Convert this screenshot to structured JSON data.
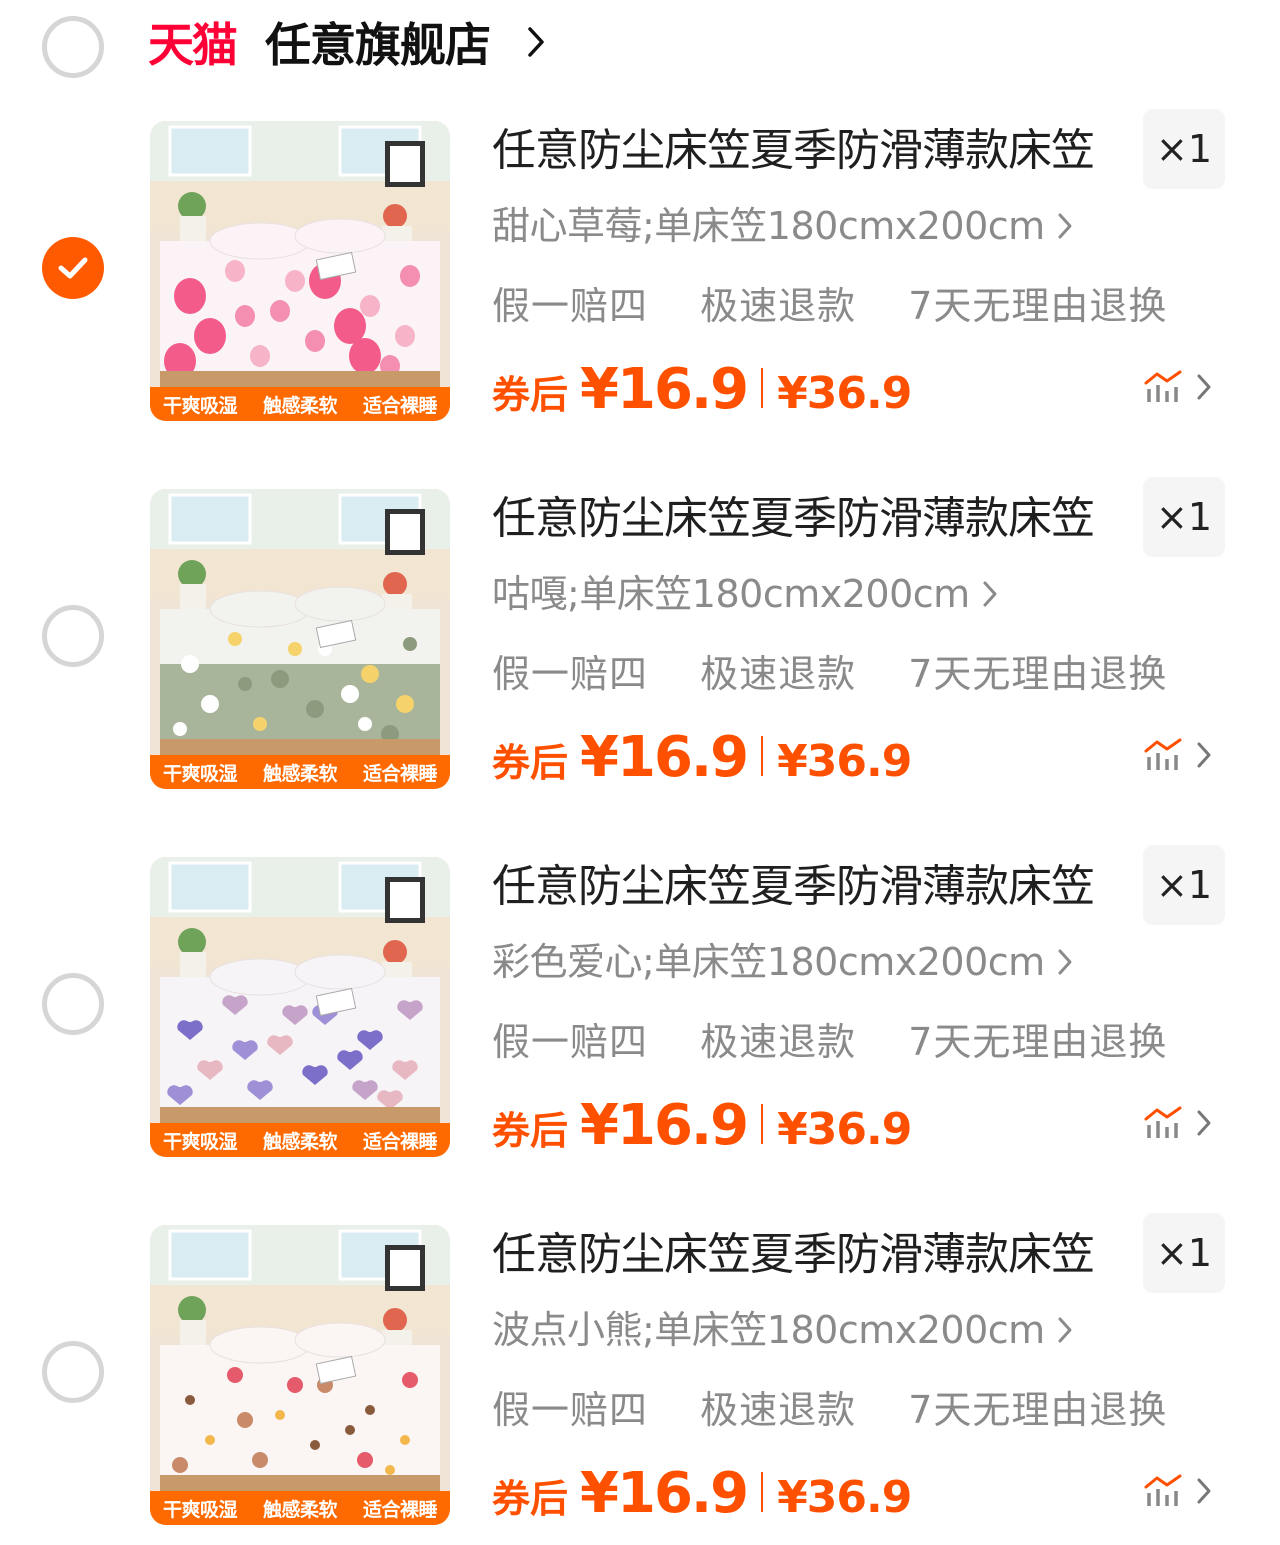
{
  "store": {
    "brand": "天猫",
    "name": "任意旗舰店",
    "selected": false
  },
  "colors": {
    "accent": "#ff5000",
    "brand_red": "#ff0036",
    "check_orange": "#ff5a00",
    "banner_orange": "#ff6a00",
    "muted_text": "#8a8a8a"
  },
  "items": [
    {
      "selected": true,
      "title": "任意防尘床笠夏季防滑薄款床笠",
      "qty": "×1",
      "sku": "甜心草莓;单床笠180cmx200cm",
      "services": [
        "假一赔四",
        "极速退款",
        "7天无理由退换"
      ],
      "coupon_label": "券后",
      "coupon_price": "¥16.9",
      "original_price": "¥36.9",
      "image_banner": [
        "干爽吸湿",
        "触感柔软",
        "适合裸睡"
      ],
      "pattern": "strawberry"
    },
    {
      "selected": false,
      "title": "任意防尘床笠夏季防滑薄款床笠",
      "qty": "×1",
      "sku": "咕嘎;单床笠180cmx200cm",
      "services": [
        "假一赔四",
        "极速退款",
        "7天无理由退换"
      ],
      "coupon_label": "券后",
      "coupon_price": "¥16.9",
      "original_price": "¥36.9",
      "image_banner": [
        "干爽吸湿",
        "触感柔软",
        "适合裸睡"
      ],
      "pattern": "duck"
    },
    {
      "selected": false,
      "title": "任意防尘床笠夏季防滑薄款床笠",
      "qty": "×1",
      "sku": "彩色爱心;单床笠180cmx200cm",
      "services": [
        "假一赔四",
        "极速退款",
        "7天无理由退换"
      ],
      "coupon_label": "券后",
      "coupon_price": "¥16.9",
      "original_price": "¥36.9",
      "image_banner": [
        "干爽吸湿",
        "触感柔软",
        "适合裸睡"
      ],
      "pattern": "hearts"
    },
    {
      "selected": false,
      "title": "任意防尘床笠夏季防滑薄款床笠",
      "qty": "×1",
      "sku": "波点小熊;单床笠180cmx200cm",
      "services": [
        "假一赔四",
        "极速退款",
        "7天无理由退换"
      ],
      "coupon_label": "券后",
      "coupon_price": "¥16.9",
      "original_price": "¥36.9",
      "image_banner": [
        "干爽吸湿",
        "触感柔软",
        "适合裸睡"
      ],
      "pattern": "bear"
    }
  ]
}
